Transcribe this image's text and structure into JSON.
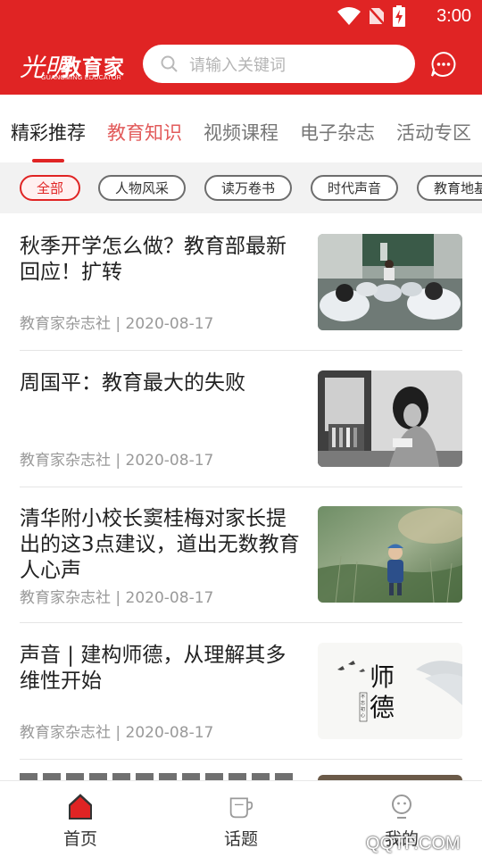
{
  "status": {
    "time": "3:00"
  },
  "header": {
    "logo_mark": "光明",
    "logo_text": "教育家",
    "logo_sub": "GUANGMING EDUCATOR",
    "search_placeholder": "请输入关键词"
  },
  "tabs": [
    {
      "label": "精彩推荐"
    },
    {
      "label": "教育知识"
    },
    {
      "label": "视频课程"
    },
    {
      "label": "电子杂志"
    },
    {
      "label": "活动专区"
    }
  ],
  "chips": [
    {
      "label": "全部"
    },
    {
      "label": "人物风采"
    },
    {
      "label": "读万卷书"
    },
    {
      "label": "时代声音"
    },
    {
      "label": "教育地基"
    }
  ],
  "articles": [
    {
      "title": "秋季开学怎么做？教育部最新回应！扩转",
      "meta": "教育家杂志社 | 2020-08-17",
      "thumb": "classroom"
    },
    {
      "title": "周国平：教育最大的失败",
      "meta": "教育家杂志社 | 2020-08-17",
      "thumb": "woman-reading"
    },
    {
      "title": "清华附小校长窦桂梅对家长提出的这3点建议，道出无数教育人心声",
      "meta": "教育家杂志社 | 2020-08-17",
      "thumb": "child-in-grass"
    },
    {
      "title": "声音 | 建构师德，从理解其多维性开始",
      "meta": "教育家杂志社 | 2020-08-17",
      "thumb": "shide-calligraphy",
      "thumb_text": "师德",
      "thumb_seal": "不忘初心"
    }
  ],
  "bottom_nav": [
    {
      "label": "首页",
      "icon": "home-icon"
    },
    {
      "label": "话题",
      "icon": "cup-icon"
    },
    {
      "label": "我的",
      "icon": "profile-icon"
    }
  ],
  "watermark": "QQTF.COM",
  "colors": {
    "brand_red": "#e02424",
    "tab_accent": "#e25b5b",
    "meta_gray": "#999999"
  }
}
